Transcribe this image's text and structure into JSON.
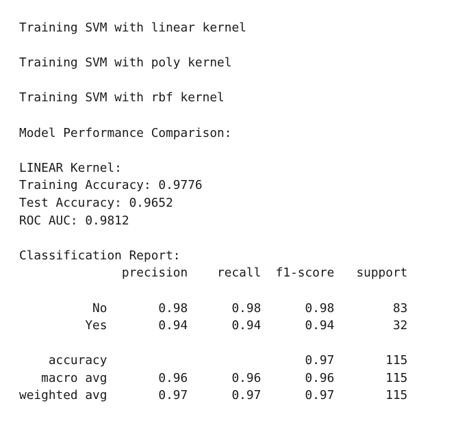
{
  "output": {
    "lines": [
      "Training SVM with linear kernel",
      "",
      "Training SVM with poly kernel",
      "",
      "Training SVM with rbf kernel",
      "",
      "Model Performance Comparison:",
      "",
      "LINEAR Kernel:",
      "Training Accuracy: 0.9776",
      "Test Accuracy: 0.9652",
      "ROC AUC: 0.9812",
      "",
      "Classification Report:",
      "              precision    recall  f1-score   support",
      "",
      "          No       0.98      0.98      0.98        83",
      "         Yes       0.94      0.94      0.94        32",
      "",
      "    accuracy                           0.97       115",
      "   macro avg       0.96      0.96      0.96       115",
      "weighted avg       0.97      0.97      0.97       115"
    ]
  }
}
